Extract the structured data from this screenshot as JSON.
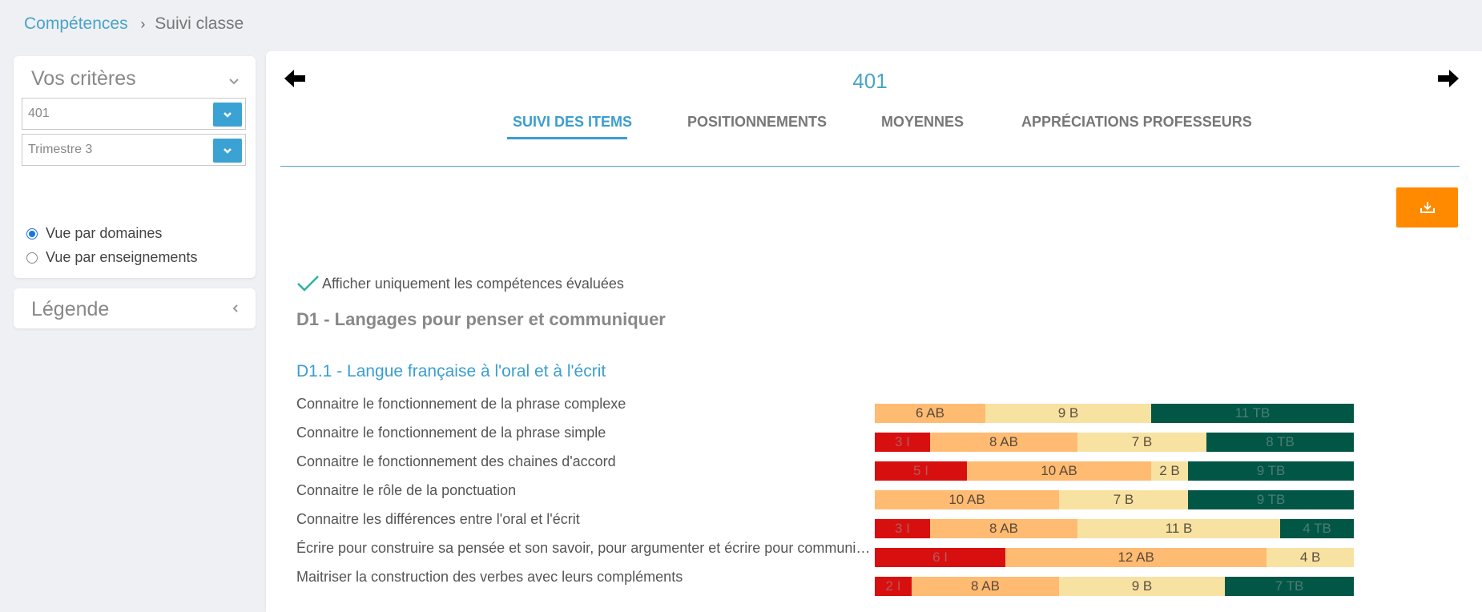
{
  "breadcrumb": {
    "parent": "Compétences",
    "current": "Suivi classe"
  },
  "criteria": {
    "title": "Vos critères",
    "class_select": "401",
    "period_select": "Trimestre 3",
    "view_domains": "Vue par domaines",
    "view_subjects": "Vue par enseignements",
    "selected_view": "domains"
  },
  "legend": {
    "title": "Légende"
  },
  "main": {
    "class_name": "401",
    "tabs": [
      "SUIVI DES ITEMS",
      "POSITIONNEMENTS",
      "MOYENNES",
      "APPRÉCIATIONS PROFESSEURS"
    ],
    "active_tab": 0,
    "filter_label": "Afficher uniquement les compétences évaluées",
    "filter_checked": true,
    "domain_title": "D1 - Langages pour penser et communiquer",
    "subdomain_title": "D1.1 - Langue française à l'oral et à l'écrit",
    "items": [
      {
        "label": "Connaitre le fonctionnement de la phrase complexe",
        "segments": [
          {
            "level": "AB",
            "count": 6,
            "text": "6 AB"
          },
          {
            "level": "B",
            "count": 9,
            "text": "9 B"
          },
          {
            "level": "TB",
            "count": 11,
            "text": "11 TB"
          }
        ]
      },
      {
        "label": "Connaitre le fonctionnement de la phrase simple",
        "segments": [
          {
            "level": "I",
            "count": 3,
            "text": "3 I"
          },
          {
            "level": "AB",
            "count": 8,
            "text": "8 AB"
          },
          {
            "level": "B",
            "count": 7,
            "text": "7 B"
          },
          {
            "level": "TB",
            "count": 8,
            "text": "8 TB"
          }
        ]
      },
      {
        "label": "Connaitre le fonctionnement des chaines d'accord",
        "segments": [
          {
            "level": "I",
            "count": 5,
            "text": "5 I"
          },
          {
            "level": "AB",
            "count": 10,
            "text": "10 AB"
          },
          {
            "level": "B",
            "count": 2,
            "text": "2 B"
          },
          {
            "level": "TB",
            "count": 9,
            "text": "9 TB"
          }
        ]
      },
      {
        "label": "Connaitre le rôle de la ponctuation",
        "segments": [
          {
            "level": "AB",
            "count": 10,
            "text": "10 AB"
          },
          {
            "level": "B",
            "count": 7,
            "text": "7 B"
          },
          {
            "level": "TB",
            "count": 9,
            "text": "9 TB"
          }
        ]
      },
      {
        "label": "Connaitre les différences entre l'oral et l'écrit",
        "segments": [
          {
            "level": "I",
            "count": 3,
            "text": "3 I"
          },
          {
            "level": "AB",
            "count": 8,
            "text": "8 AB"
          },
          {
            "level": "B",
            "count": 11,
            "text": "11 B"
          },
          {
            "level": "TB",
            "count": 4,
            "text": "4 TB"
          }
        ]
      },
      {
        "label": "Écrire pour construire sa pensée et son savoir, pour argumenter et écrire pour communiquer et échanger",
        "segments": [
          {
            "level": "I",
            "count": 6,
            "text": "6 I"
          },
          {
            "level": "AB",
            "count": 12,
            "text": "12 AB"
          },
          {
            "level": "B",
            "count": 4,
            "text": "4 B"
          }
        ]
      },
      {
        "label": "Maitriser la construction des verbes avec leurs compléments",
        "segments": [
          {
            "level": "I",
            "count": 2,
            "text": "2 I"
          },
          {
            "level": "AB",
            "count": 8,
            "text": "8 AB"
          },
          {
            "level": "B",
            "count": 9,
            "text": "9 B"
          },
          {
            "level": "TB",
            "count": 7,
            "text": "7 TB"
          }
        ]
      }
    ]
  },
  "colors": {
    "I": "#d80f0f",
    "AB": "#ffbb72",
    "B": "#f8e2a2",
    "TB": "#025646",
    "accent": "#3a9ed0",
    "export": "#ff8a00"
  }
}
